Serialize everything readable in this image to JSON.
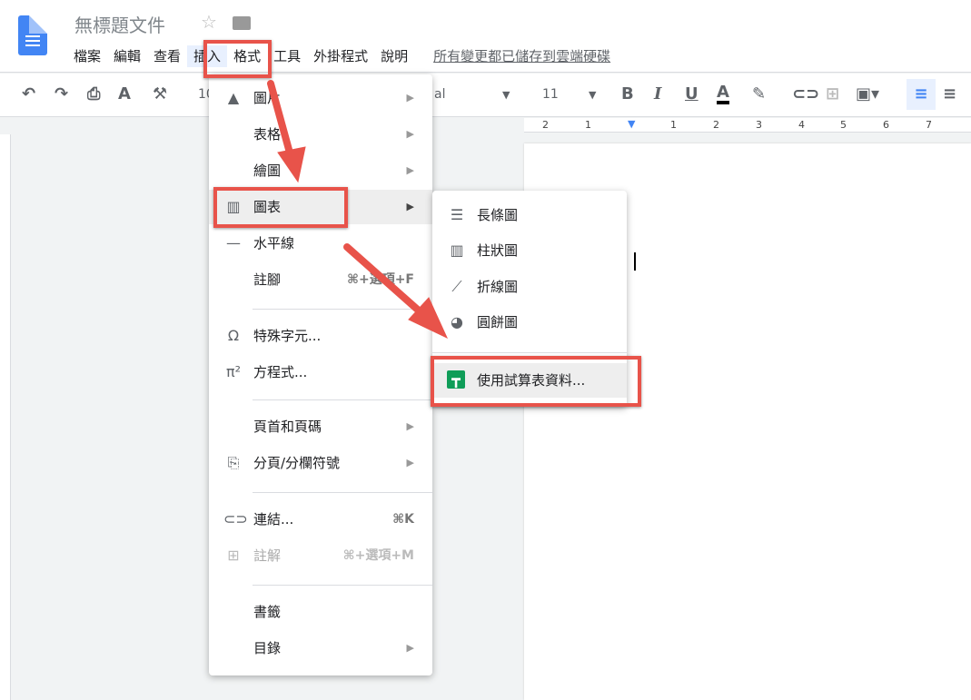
{
  "doc": {
    "title": "無標題文件",
    "saved_status": "所有變更都已儲存到雲端硬碟"
  },
  "menubar": [
    "檔案",
    "編輯",
    "查看",
    "插入",
    "格式",
    "工具",
    "外掛程式",
    "說明"
  ],
  "toolbar": {
    "zoom": "10",
    "font": "al",
    "font_size": "11"
  },
  "ruler": [
    "2",
    "1",
    "1",
    "2",
    "3",
    "4",
    "5",
    "6",
    "7"
  ],
  "insert_menu": [
    {
      "label": "圖片",
      "icon": "image-icon",
      "submenu": true
    },
    {
      "label": "表格",
      "submenu": true
    },
    {
      "label": "繪圖",
      "submenu": true
    },
    {
      "label": "圖表",
      "icon": "chart-icon",
      "submenu": true,
      "highlighted": true
    },
    {
      "label": "水平線",
      "icon": "horizontal-line-icon"
    },
    {
      "label": "註腳",
      "shortcut": "⌘+選項+F"
    },
    {
      "label": "特殊字元...",
      "icon": "omega-icon"
    },
    {
      "label": "方程式...",
      "icon": "pi-icon"
    },
    {
      "label": "頁首和頁碼",
      "submenu": true
    },
    {
      "label": "分頁/分欄符號",
      "icon": "page-break-icon",
      "submenu": true
    },
    {
      "label": "連結...",
      "icon": "link-icon",
      "shortcut": "⌘K"
    },
    {
      "label": "註解",
      "icon": "comment-icon",
      "shortcut": "⌘+選項+M",
      "disabled": true
    },
    {
      "label": "書籤"
    },
    {
      "label": "目錄",
      "submenu": true
    }
  ],
  "chart_submenu": [
    {
      "label": "長條圖",
      "icon": "bar-chart-icon"
    },
    {
      "label": "柱狀圖",
      "icon": "column-chart-icon"
    },
    {
      "label": "折線圖",
      "icon": "line-chart-icon"
    },
    {
      "label": "圓餅圖",
      "icon": "pie-chart-icon"
    },
    {
      "label": "使用試算表資料...",
      "icon": "sheets-icon",
      "highlighted": true
    }
  ],
  "colors": {
    "annotation": "#e8534a",
    "sheets": "#0f9d58",
    "accent": "#4285f4"
  }
}
